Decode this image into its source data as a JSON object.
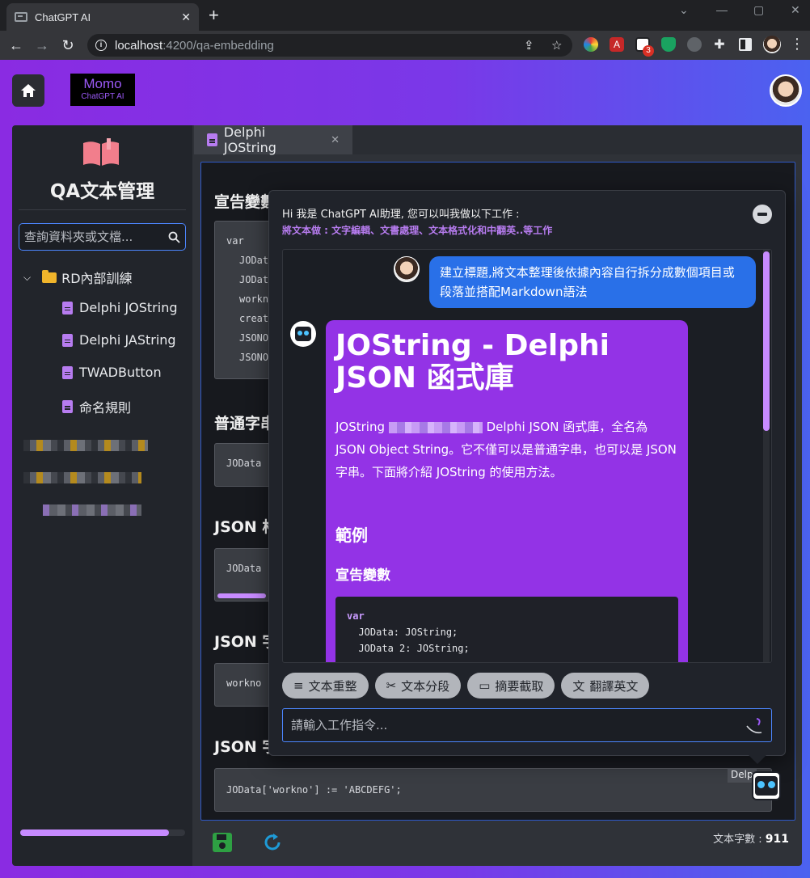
{
  "browser": {
    "tab_title": "ChatGPT AI",
    "new_tab": "+",
    "url_host": "localhost",
    "url_path": ":4200/qa-embedding",
    "extension_badge": "3"
  },
  "header": {
    "logo_title": "Momo",
    "logo_subtitle": "ChatGPT AI"
  },
  "sidebar": {
    "title": "QA文本管理",
    "search_placeholder": "查詢資料夾或文檔...",
    "folder": "RD內部訓練",
    "files": [
      "Delphi JOString",
      "Delphi JAString",
      "TWADButton",
      "命名規則"
    ]
  },
  "document": {
    "tab_label": "Delphi JOString",
    "headings": [
      "宣告變數",
      "普通字串",
      "JSON 格",
      "JSON 字",
      "JSON 字"
    ],
    "code_block_1": [
      "var",
      "JOData",
      "JOData",
      "workno",
      "creat",
      "JSONO",
      "JSONO"
    ],
    "code_snippet_2": "JOData",
    "code_snippet_3": "JOData",
    "code_snippet_4": "workno",
    "code_snippet_5": "JOData['workno'] := 'ABCDEFG';",
    "word_count_label": "文本字數 :",
    "word_count": "911"
  },
  "chat": {
    "greeting": "Hi 我是 ChatGPT AI助理, 您可以叫我做以下工作 :",
    "capabilities": "將文本做 : 文字編輯、文書處理、文本格式化和中翻英..等工作",
    "user_message": "建立標題,將文本整理後依據內容自行拆分成數個項目或段落並搭配Markdown語法",
    "bot_title": "JOString - Delphi JSON 函式庫",
    "bot_para_start": "JOString",
    "bot_para_rest": "Delphi JSON 函式庫，全名為 JSON Object String。它不僅可以是普通字串，也可以是 JSON 字串。下面將介紹 JOString 的使用方法。",
    "bot_h2": "範例",
    "bot_h3": "宣告變數",
    "bot_code": [
      "var",
      "  JOData: JOString;",
      "  JOData 2: JOString;"
    ],
    "actions": [
      "文本重整",
      "文本分段",
      "摘要截取",
      "翻譯英文"
    ],
    "input_placeholder": "請輸入工作指令...",
    "float_label": "Delp"
  }
}
